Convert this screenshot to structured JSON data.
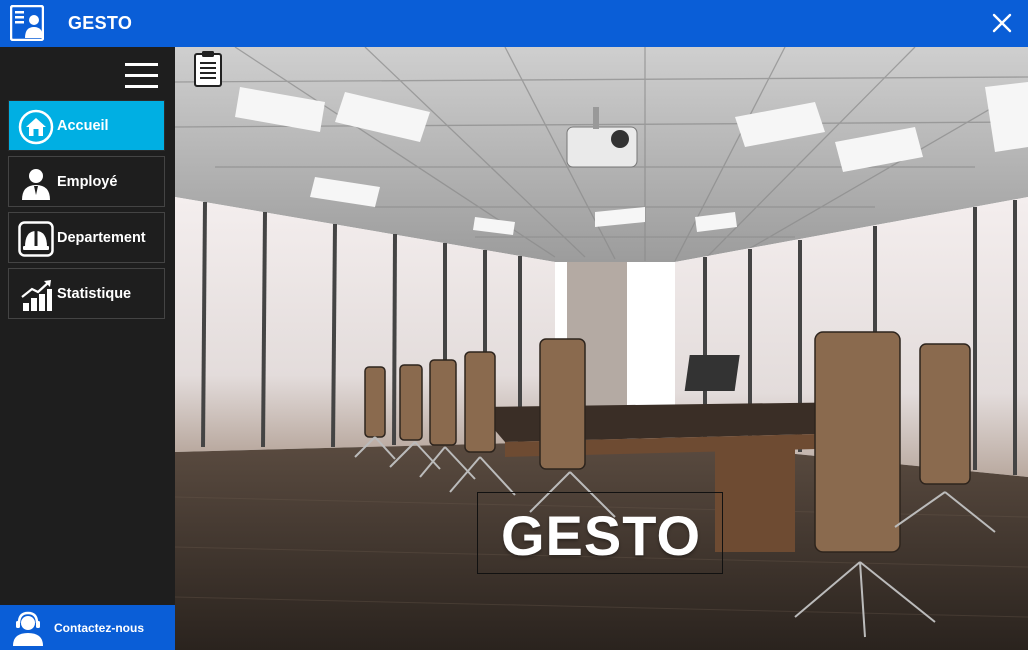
{
  "app": {
    "title": "GESTO",
    "logo": "id-badge-icon",
    "close": "close-icon"
  },
  "sidebar": {
    "menu": "hamburger-menu-icon",
    "items": [
      {
        "label": "Accueil",
        "icon": "home-icon",
        "active": true
      },
      {
        "label": "Employé",
        "icon": "employee-icon",
        "active": false
      },
      {
        "label": "Departement",
        "icon": "helmet-icon",
        "active": false
      },
      {
        "label": "Statistique",
        "icon": "chart-icon",
        "active": false
      }
    ],
    "contact": {
      "label": "Contactez-nous",
      "icon": "support-agent-icon"
    }
  },
  "main": {
    "toolbar_icon": "clipboard-icon",
    "hero_title": "GESTO",
    "hero_image": "conference-room-photo"
  },
  "colors": {
    "titlebar": "#0A5ED7",
    "sidebar": "#1E1E1E",
    "active_item": "#00AFE3"
  }
}
